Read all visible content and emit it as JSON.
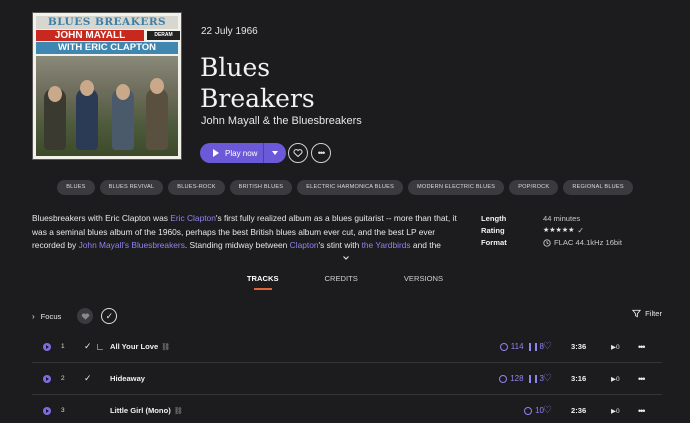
{
  "album": {
    "cover": {
      "line1": "BLUES BREAKERS",
      "line2": "JOHN MAYALL",
      "label": "DERAM",
      "line3": "WITH ERIC CLAPTON"
    },
    "date": "22 July 1966",
    "title_line1": "Blues",
    "title_line2": "Breakers",
    "artist": "John Mayall & the Bluesbreakers",
    "play_label": "Play now"
  },
  "genres": [
    "BLUES",
    "BLUES REVIVAL",
    "BLUES-ROCK",
    "BRITISH BLUES",
    "ELECTRIC HARMONICA BLUES",
    "MODERN ELECTRIC BLUES",
    "POP/ROCK",
    "REGIONAL BLUES"
  ],
  "description": {
    "t1": "Bluesbreakers with Eric Clapton was ",
    "l1": "Eric Clapton",
    "t2": "'s first fully realized album as a blues guitarist -- more than that, it was a seminal blues album of the 1960s, perhaps the best British blues album ever cut, and the best LP ever recorded by ",
    "l2": "John Mayall's Bluesbreakers",
    "t3": ". Standing midway between ",
    "l3": "Clapton",
    "t4": "'s stint with ",
    "l4": "the Yardbirds",
    "t5": " and the"
  },
  "meta": {
    "length_label": "Length",
    "length_value": "44 minutes",
    "rating_label": "Rating",
    "rating_value": "★★★★★",
    "format_label": "Format",
    "format_value": "FLAC 44.1kHz 16bit"
  },
  "tabs": [
    "TRACKS",
    "CREDITS",
    "VERSIONS"
  ],
  "toolbar": {
    "focus_label": "Focus",
    "filter_label": "Filter"
  },
  "tracks": [
    {
      "num": "1",
      "name": "All Your Love",
      "stat1": "114",
      "stat2": "8",
      "duration": "3:36",
      "plays": "0"
    },
    {
      "num": "2",
      "name": "Hideaway",
      "stat1": "128",
      "stat2": "3",
      "duration": "3:16",
      "plays": "0"
    },
    {
      "num": "3",
      "name": "Little Girl (Mono)",
      "stat1": "10",
      "stat2": "",
      "duration": "2:36",
      "plays": "0"
    }
  ]
}
